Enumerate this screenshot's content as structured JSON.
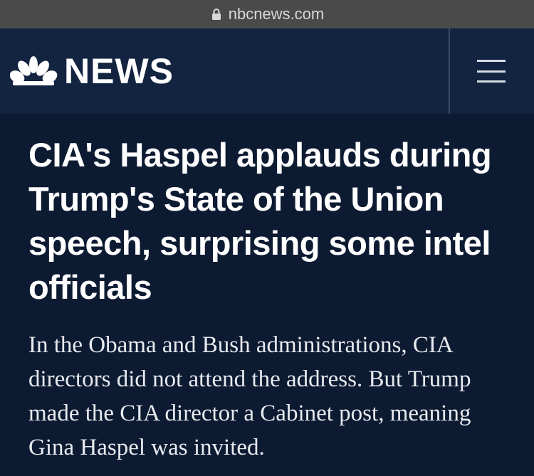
{
  "browser": {
    "url": "nbcnews.com",
    "lock_icon": "lock-icon"
  },
  "header": {
    "logo_icon": "nbc-peacock-icon",
    "brand_text": "NEWS",
    "menu_icon": "hamburger-menu-icon"
  },
  "article": {
    "headline": "CIA's Haspel applauds during Trump's State of the Union speech, surprising some intel officials",
    "dek": "In the Obama and Bush administrations, CIA directors did not attend the address. But Trump made the CIA director a Cabinet post, meaning Gina Haspel was invited."
  },
  "colors": {
    "page_bg": "#0d1b32",
    "header_bg": "#132441",
    "browser_bar": "#4a4a4a",
    "text": "#ffffff"
  }
}
